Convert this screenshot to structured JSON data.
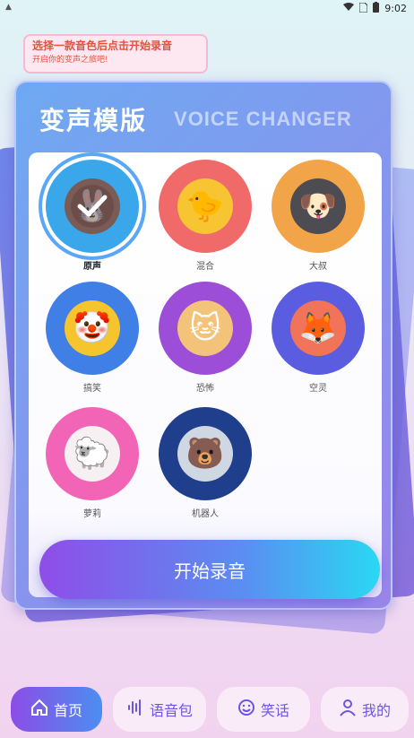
{
  "status_bar": {
    "left_icon": "app-notification-icon",
    "time": "9:02",
    "icons": [
      "wifi-icon",
      "sim-icon",
      "battery-icon"
    ]
  },
  "banner": {
    "title": "选择一款音色后点击开始录音",
    "subtitle": "开启你的变声之旅吧!"
  },
  "card": {
    "title": "变声模版",
    "subtitle": "VOICE CHANGER"
  },
  "voices": [
    {
      "label": "原声",
      "selected": true,
      "bg": "#3aa7ea",
      "face": "#7b5b55",
      "icon": "rabbit-icon"
    },
    {
      "label": "混合",
      "selected": false,
      "bg": "#f06a6a",
      "face": "#f7c531",
      "icon": "duck-icon"
    },
    {
      "label": "大叔",
      "selected": false,
      "bg": "#f2a548",
      "face": "#4c4c52",
      "icon": "dog-icon"
    },
    {
      "label": "搞笑",
      "selected": false,
      "bg": "#3f7fe6",
      "face": "#f6c52e",
      "icon": "clown-icon"
    },
    {
      "label": "恐怖",
      "selected": false,
      "bg": "#9c4ed8",
      "face": "#f3c37a",
      "icon": "cat-icon"
    },
    {
      "label": "空灵",
      "selected": false,
      "bg": "#5a5de0",
      "face": "#f0735a",
      "icon": "fox-icon"
    },
    {
      "label": "萝莉",
      "selected": false,
      "bg": "#f265b6",
      "face": "#f7f0f2",
      "icon": "sheep-icon"
    },
    {
      "label": "机器人",
      "selected": false,
      "bg": "#1f3e8c",
      "face": "#cfd7e3",
      "icon": "robot-bear-icon"
    }
  ],
  "record_button": "开始录音",
  "nav": [
    {
      "label": "首页",
      "icon": "home-icon",
      "active": true
    },
    {
      "label": "语音包",
      "icon": "soundwave-icon",
      "active": false
    },
    {
      "label": "笑话",
      "icon": "smile-icon",
      "active": false
    },
    {
      "label": "我的",
      "icon": "user-icon",
      "active": false
    }
  ],
  "colors": {
    "accent": "#6a57e0",
    "banner_text": "#e8503a",
    "selection_ring": "#5aa6f8"
  }
}
